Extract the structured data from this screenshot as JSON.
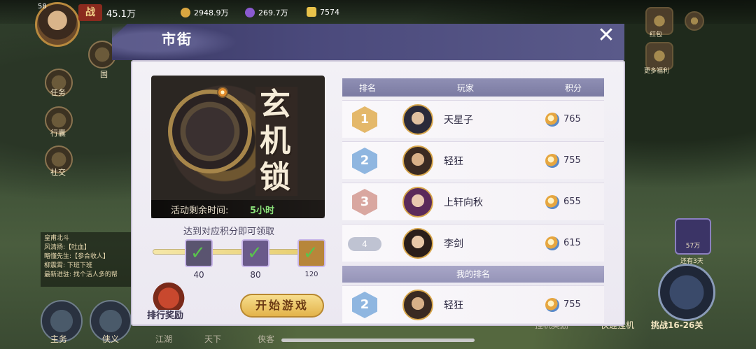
{
  "hud": {
    "level": "58",
    "power_badge": "战",
    "power_value": "45.1万",
    "currency": [
      {
        "icon": "copper-coin-icon",
        "value": "2948.9万",
        "color": "#d9a640"
      },
      {
        "icon": "purple-gem-icon",
        "value": "269.7万",
        "color": "#8a5ad0"
      },
      {
        "icon": "gold-ingot-icon",
        "value": "7574",
        "color": "#e8c24a"
      }
    ],
    "side_menu": [
      {
        "label": "任务",
        "icon": "quest-scroll-icon"
      },
      {
        "label": "行囊",
        "icon": "bag-icon"
      },
      {
        "label": "社交",
        "icon": "social-icon"
      }
    ],
    "hero_label": "国",
    "quest_log": [
      "皇甫北斗",
      "风清扬:【吐血】",
      "略懂先生:【参合收人】",
      "柳震霄: 下班下班",
      "最新进驻: 找个活人多的帮"
    ],
    "right_labels": {
      "top_right": "红包",
      "events": "更多福利"
    },
    "coin_box_value": "57万",
    "coin_box_label": "还有3天",
    "bottom_nav": [
      "主务",
      "侠义",
      "江湖",
      "天下",
      "侠客"
    ],
    "bottom_right": [
      "挂机奖励",
      "快速挂机"
    ],
    "challenge_label": "挑战16-26关"
  },
  "panel": {
    "title": "市街",
    "close_label": "✕",
    "banner": {
      "title": "玄机锁",
      "time_label": "活动剩余时间:",
      "time_value": "5小时"
    },
    "reward_hint": "达到对应积分即可领取",
    "progress": {
      "fill_fraction": 0.92,
      "milestones": [
        {
          "value": "40",
          "claimed": true,
          "color": "#5a5470"
        },
        {
          "value": "80",
          "claimed": true,
          "color": "#6a5a8a"
        },
        {
          "value": "120",
          "claimed": true,
          "color": "#b7863a"
        }
      ]
    },
    "rank_reward_label": "排行奖励",
    "start_button": "开始游戏"
  },
  "ranking": {
    "headers": [
      "排名",
      "玩家",
      "积分"
    ],
    "rows": [
      {
        "rank": "1",
        "name": "天星子",
        "score": "765",
        "medal_color": "#e4b86a"
      },
      {
        "rank": "2",
        "name": "轻狂",
        "score": "755",
        "medal_color": "#8fb6e0"
      },
      {
        "rank": "3",
        "name": "上轩向秋",
        "score": "655",
        "medal_color": "#d9a7a0"
      },
      {
        "rank": "4",
        "name": "李剑",
        "score": "615",
        "medal_color": ""
      }
    ],
    "my_rank_title": "我的排名",
    "my_rank": {
      "rank": "2",
      "name": "轻狂",
      "score": "755",
      "medal_color": "#8fb6e0"
    }
  }
}
